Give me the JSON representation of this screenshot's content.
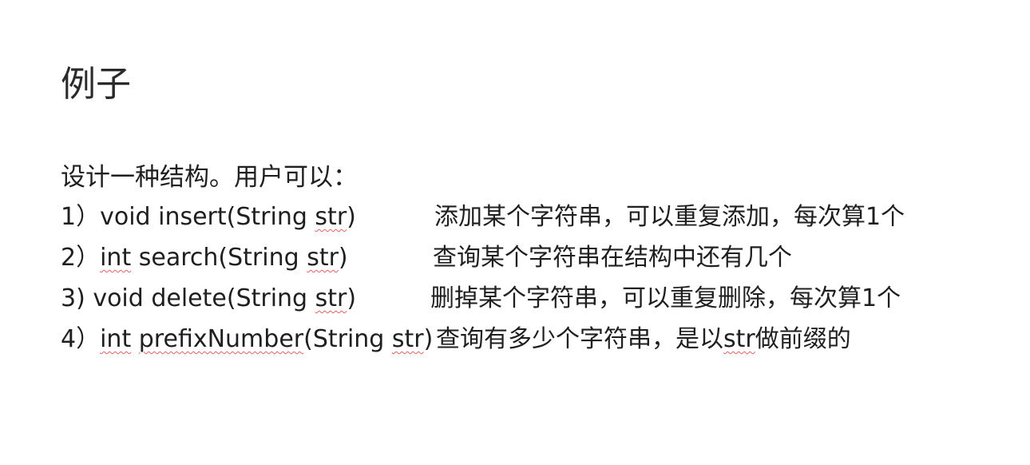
{
  "title": "例子",
  "intro": "设计一种结构。用户可以：",
  "items": [
    {
      "num": "1）",
      "sig_parts": [
        "void insert(String ",
        "str",
        ")"
      ],
      "desc": "添加某个字符串，可以重复添加，每次算1个"
    },
    {
      "num": "2）",
      "sig_parts": [
        "int",
        " search(String ",
        "str",
        ")"
      ],
      "desc": "查询某个字符串在结构中还有几个"
    },
    {
      "num": "3)  ",
      "sig_parts": [
        "void delete(String ",
        "str",
        ")"
      ],
      "desc": "删掉某个字符串，可以重复删除，每次算1个"
    },
    {
      "num": "4）",
      "sig_parts": [
        "int",
        " ",
        "prefixNumber",
        "(String ",
        "str",
        ")"
      ],
      "desc_parts": [
        "查询有多少个字符串，是以",
        "str",
        "做前缀的"
      ]
    }
  ]
}
